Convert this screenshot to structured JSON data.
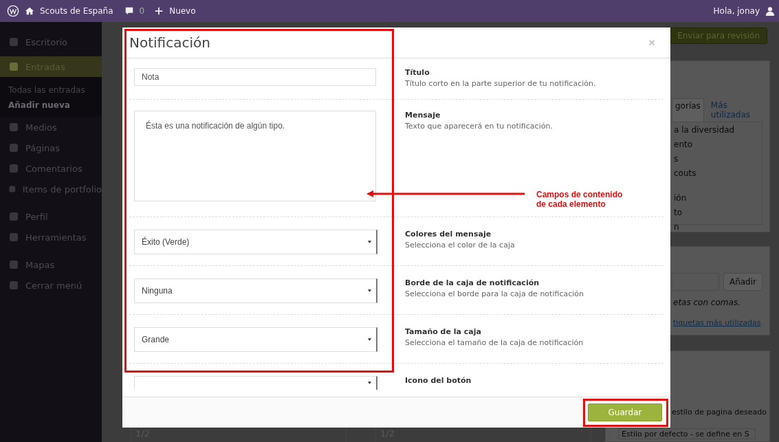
{
  "admin_bar": {
    "site_name": "Scouts de España",
    "comments_count": "0",
    "new_label": "Nuevo",
    "greeting": "Hola, jonay"
  },
  "sidebar": {
    "items": [
      {
        "label": "Escritorio",
        "selected": false
      },
      {
        "label": "Entradas",
        "selected": true,
        "submenu": [
          {
            "label": "Todas las entradas",
            "selected": false
          },
          {
            "label": "Añadir nueva",
            "selected": true
          }
        ]
      },
      {
        "label": "Medios",
        "selected": false
      },
      {
        "label": "Páginas",
        "selected": false
      },
      {
        "label": "Comentarios",
        "selected": false
      },
      {
        "label": "Items de portfolio",
        "selected": false
      },
      {
        "label": "Perfil",
        "selected": false
      },
      {
        "label": "Herramientas",
        "selected": false
      },
      {
        "label": "Mapas",
        "selected": false
      },
      {
        "label": "Cerrar menú",
        "selected": false
      }
    ]
  },
  "background": {
    "submit_button": "Enviar para revisión",
    "category_tabs": [
      {
        "label": "gorías",
        "selected": true
      },
      {
        "label": "Más utilizadas",
        "selected": false
      }
    ],
    "categories": [
      "a la diversidad",
      "ento",
      "s",
      "couts",
      "ión",
      "to",
      "n"
    ],
    "tags_add_button": "Añadir",
    "tags_hint": "etas con comas.",
    "tags_link": "tiquetas más utilizadas",
    "page_style_label": "estilo de pagina deseado",
    "page_style_select": "Estilo por defecto - se define en S",
    "editor_values": [
      "1/2",
      "1/2"
    ]
  },
  "modal": {
    "title": "Notificación",
    "fields": [
      {
        "kind": "text",
        "value": "Nota",
        "label": "Título",
        "description": "Título corto en la parte superior de tu notificación."
      },
      {
        "kind": "textarea",
        "value": "Ésta es una notificación de algún tipo.",
        "label": "Mensaje",
        "description": "Texto que aparecerá en tu notificación."
      },
      {
        "kind": "select",
        "value": "Éxito (Verde)",
        "label": "Colores del mensaje",
        "description": "Selecciona el color de la caja"
      },
      {
        "kind": "select",
        "value": "Ninguna",
        "label": "Borde de la caja de notificación",
        "description": "Selecciona el borde para la caja de notificación"
      },
      {
        "kind": "select",
        "value": "Grande",
        "label": "Tamaño de la caja",
        "description": "Selecciona el tamaño de la caja de notificación"
      },
      {
        "kind": "select",
        "label": "Icono del botón"
      }
    ],
    "save_button": "Guardar"
  },
  "annotation": {
    "text": "Campos de contenido de cada elemento"
  }
}
